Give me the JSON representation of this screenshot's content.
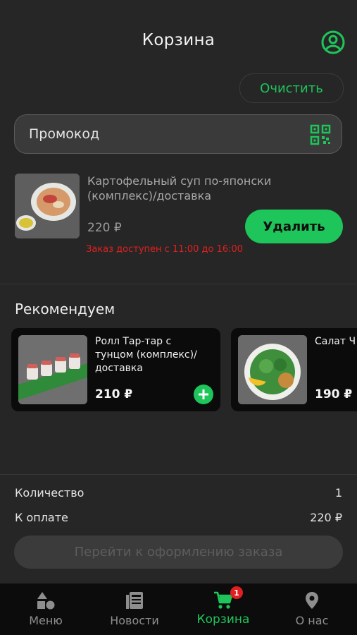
{
  "header": {
    "title": "Корзина",
    "clear_label": "Очистить"
  },
  "promo": {
    "placeholder": "Промокод"
  },
  "cart_item": {
    "name": "Картофельный суп по-японски (комплекс)/доставка",
    "price": "220 ₽",
    "delete_label": "Удалить",
    "availability": "Заказ доступен с 11:00 до 16:00"
  },
  "recommend": {
    "title": "Рекомендуем",
    "items": [
      {
        "name": "Ролл Тар-тар с тунцом (комплекс)/ доставка",
        "price": "210 ₽"
      },
      {
        "name": "Салат Ч (компле",
        "price": "190 ₽"
      }
    ]
  },
  "summary": {
    "qty_label": "Количество",
    "qty_value": "1",
    "total_label": "К оплате",
    "total_value": "220 ₽",
    "checkout_label": "Перейти к оформлению заказа"
  },
  "nav": {
    "items": [
      {
        "label": "Меню",
        "icon": "menu-shapes-icon"
      },
      {
        "label": "Новости",
        "icon": "news-icon"
      },
      {
        "label": "Корзина",
        "icon": "cart-icon",
        "badge": "1"
      },
      {
        "label": "О нас",
        "icon": "location-pin-icon"
      }
    ]
  },
  "colors": {
    "accent": "#1ec55a",
    "background": "#262626",
    "warning": "#e02020",
    "nav_bg": "#0c0c0c"
  }
}
